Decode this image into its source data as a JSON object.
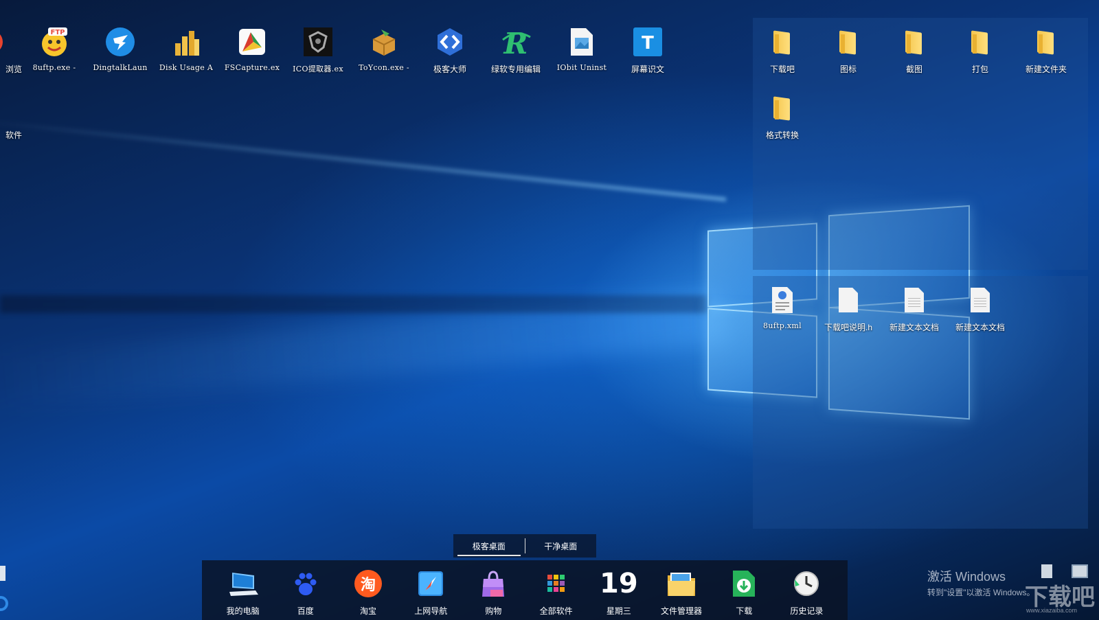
{
  "desktop_icons_top": [
    {
      "label": "浏览",
      "icon": "browser-icon"
    },
    {
      "label": "8uftp.exe -",
      "icon": "ftp-icon"
    },
    {
      "label": "DingtalkLaun",
      "icon": "dingtalk-icon"
    },
    {
      "label": "Disk Usage A",
      "icon": "disk-usage-icon"
    },
    {
      "label": "FSCapture.ex",
      "icon": "fscapture-icon"
    },
    {
      "label": "ICO提取器.ex",
      "icon": "ico-extractor-icon"
    },
    {
      "label": "ToYcon.exe -",
      "icon": "toycon-icon"
    },
    {
      "label": "极客大师",
      "icon": "geek-master-icon"
    },
    {
      "label": "绿软专用编辑",
      "icon": "editor-icon"
    },
    {
      "label": "IObit Uninst",
      "icon": "image-file-icon"
    },
    {
      "label": "屏幕识文",
      "icon": "screen-ocr-icon"
    }
  ],
  "desktop_icon_second_row": {
    "label": "软件",
    "icon": "folder-icon"
  },
  "fence_top_items": [
    "下载吧",
    "图标",
    "截图",
    "打包",
    "新建文件夹",
    "格式转换"
  ],
  "fence_bottom_items": [
    "8uftp.xml",
    "下载吧说明.h",
    "新建文本文档",
    "新建文本文档"
  ],
  "tabs": {
    "geek_desktop": "极客桌面",
    "clean_desktop": "干净桌面"
  },
  "dock": [
    {
      "label": "我的电脑",
      "icon": "computer-icon"
    },
    {
      "label": "百度",
      "icon": "baidu-paw-icon"
    },
    {
      "label": "淘宝",
      "icon": "taobao-icon",
      "glyph": "淘"
    },
    {
      "label": "上网导航",
      "icon": "compass-icon"
    },
    {
      "label": "购物",
      "icon": "shopping-bag-icon"
    },
    {
      "label": "全部软件",
      "icon": "grid-apps-icon"
    },
    {
      "label": "星期三",
      "icon": "calendar-day",
      "day": "19"
    },
    {
      "label": "文件管理器",
      "icon": "file-manager-icon"
    },
    {
      "label": "下载",
      "icon": "download-icon"
    },
    {
      "label": "历史记录",
      "icon": "history-clock-icon"
    }
  ],
  "activation": {
    "line1": "激活 Windows",
    "line2": "转到\"设置\"以激活 Windows。"
  },
  "watermark": {
    "text": "下载吧",
    "url": "www.xiazaiba.com"
  }
}
